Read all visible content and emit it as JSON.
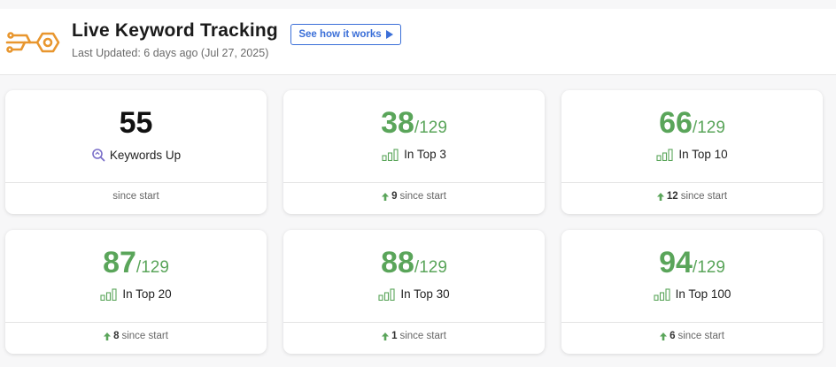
{
  "header": {
    "title": "Live Keyword Tracking",
    "how_button": "See how it works",
    "updated": "Last Updated: 6 days ago (Jul 27, 2025)"
  },
  "colors": {
    "accent_green": "#5aa55a",
    "button_blue": "#3b6fd8",
    "logo_orange": "#e8962e"
  },
  "cards": [
    {
      "value": "55",
      "denom": "",
      "label": "Keywords Up",
      "icon": "magnifier-icon",
      "delta": "",
      "footer": "since start"
    },
    {
      "value": "38",
      "denom": "/129",
      "label": "In Top 3",
      "icon": "bar-chart-icon",
      "delta": "9",
      "footer": "since start"
    },
    {
      "value": "66",
      "denom": "/129",
      "label": "In Top 10",
      "icon": "bar-chart-icon",
      "delta": "12",
      "footer": "since start"
    },
    {
      "value": "87",
      "denom": "/129",
      "label": "In Top 20",
      "icon": "bar-chart-icon",
      "delta": "8",
      "footer": "since start"
    },
    {
      "value": "88",
      "denom": "/129",
      "label": "In Top 30",
      "icon": "bar-chart-icon",
      "delta": "1",
      "footer": "since start"
    },
    {
      "value": "94",
      "denom": "/129",
      "label": "In Top 100",
      "icon": "bar-chart-icon",
      "delta": "6",
      "footer": "since start"
    }
  ]
}
